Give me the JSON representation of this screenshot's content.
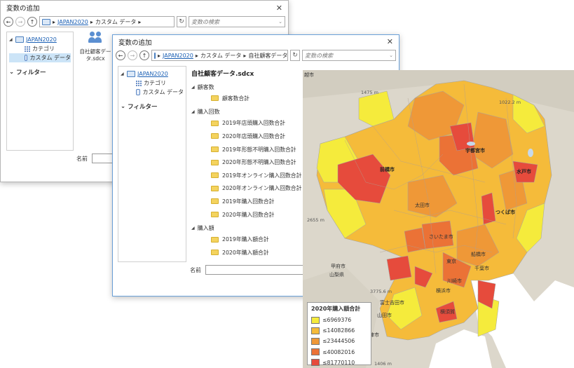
{
  "dialog_back": {
    "title": "変数の追加",
    "path": [
      "JAPAN2020",
      "カスタム データ"
    ],
    "search_placeholder": "変数の検索",
    "tree": {
      "root": "JAPAN2020",
      "children": [
        "カテゴリ",
        "カスタム データ"
      ]
    },
    "filter_label": "フィルター",
    "tile_label": "自社顧客データ.sdcx",
    "name_label": "名前"
  },
  "dialog_front": {
    "title": "変数の追加",
    "path": [
      "JAPAN2020",
      "カスタム データ",
      "自社顧客データ.sdcx"
    ],
    "search_placeholder": "変数の検索",
    "tree": {
      "root": "JAPAN2020",
      "children": [
        "カテゴリ",
        "カスタム データ"
      ]
    },
    "filter_label": "フィルター",
    "section_title": "自社顧客データ.sdcx",
    "groups": [
      {
        "label": "顧客数",
        "items": [
          "顧客数合計"
        ]
      },
      {
        "label": "購入回数",
        "items": [
          "2019年店頭購入回数合計",
          "2020年店頭購入回数合計",
          "2019年形態不明購入回数合計",
          "2020年形態不明購入回数合計",
          "2019年オンライン購入回数合計",
          "2020年オンライン購入回数合計",
          "2019年購入回数合計",
          "2020年購入回数合計"
        ]
      },
      {
        "label": "購入額",
        "items": [
          "2019年購入額合計",
          "2020年購入額合計"
        ]
      }
    ],
    "name_label": "名前"
  },
  "map": {
    "legend_title": "2020年購入額合計",
    "legend": [
      {
        "label": "≤6969376",
        "color": "#f5eb3c"
      },
      {
        "label": "≤14082866",
        "color": "#f5bb3a"
      },
      {
        "label": "≤23444506",
        "color": "#ef9837"
      },
      {
        "label": "≤40082016",
        "color": "#eb7236"
      },
      {
        "label": "≤81770110",
        "color": "#e64b3c"
      }
    ],
    "place_labels": [
      "越市",
      "前橋市",
      "宇都宮市",
      "水戸市",
      "太田市",
      "つくば市",
      "甲府市",
      "山梨県",
      "富士吉田市",
      "横須賀",
      "沼津市",
      "山田市",
      "千葉市",
      "東京",
      "川崎市",
      "横浜市",
      "さいたま市",
      "船橋市"
    ],
    "elevation_labels": [
      "1475 m",
      "1022.2 m",
      "2655 m",
      "3775.6 m",
      "1406 m"
    ]
  }
}
